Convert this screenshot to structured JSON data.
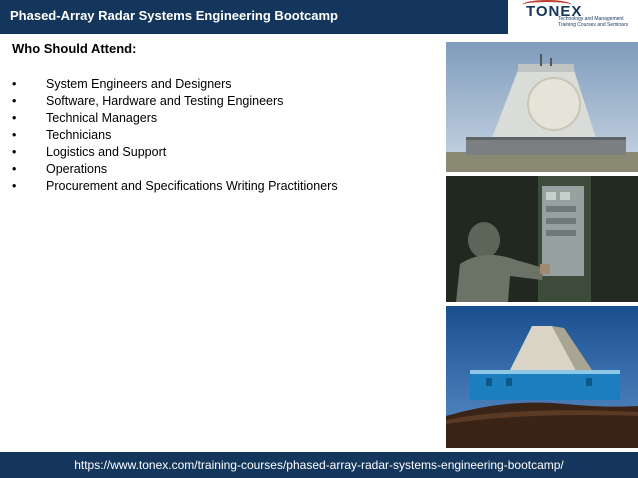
{
  "header": {
    "title": "Phased-Array Radar Systems Engineering Bootcamp",
    "logo_name": "TONEX",
    "logo_tagline": "Technology and Management Training Courses and Seminars"
  },
  "content": {
    "heading": "Who Should Attend:",
    "bullet_symbol": "•",
    "items": [
      "System Engineers and Designers",
      "Software, Hardware and Testing Engineers",
      "Technical Managers",
      "Technicians",
      "Logistics and Support",
      "Operations",
      "Procurement and Specifications Writing Practitioners"
    ]
  },
  "footer": {
    "url": "https://www.tonex.com/training-courses/phased-array-radar-systems-engineering-bootcamp/"
  },
  "colors": {
    "header_bg": "#14365c",
    "footer_bg": "#14365c"
  },
  "images": [
    "radar-building-photo",
    "radar-equipment-photo",
    "radar-pyramid-photo"
  ]
}
